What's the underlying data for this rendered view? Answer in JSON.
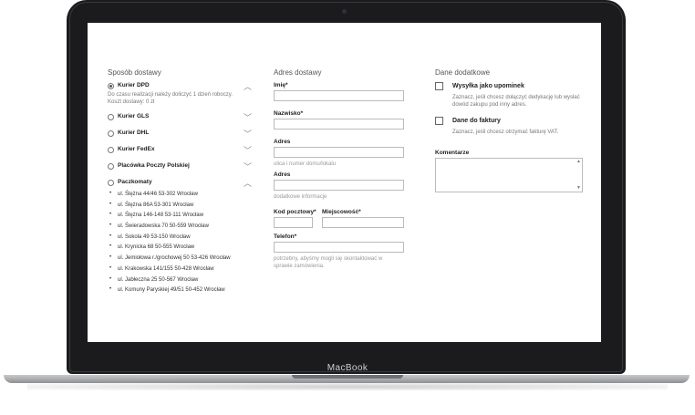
{
  "device": {
    "brand": "MacBook"
  },
  "delivery": {
    "title": "Sposób dostawy",
    "options": [
      {
        "label": "Kurier DPD",
        "selected": true,
        "expanded": true
      },
      {
        "label": "Kurier GLS",
        "selected": false,
        "expanded": false
      },
      {
        "label": "Kurier DHL",
        "selected": false,
        "expanded": false
      },
      {
        "label": "Kurier FedEx",
        "selected": false,
        "expanded": false
      },
      {
        "label": "Placówka Poczty Polskiej",
        "selected": false,
        "expanded": false
      },
      {
        "label": "Paczkomaty",
        "selected": false,
        "expanded": true
      }
    ],
    "dpd_note_1": "Do czasu realizacji należy doliczyć 1 dzień roboczy.",
    "dpd_note_2": "Koszt dostawy: 0 zł",
    "paczkomaty": [
      "ul. Ślężna 44/46 53-302 Wrocław",
      "ul. Ślężna 86A 53-301 Wrocław",
      "ul. Ślężna 146-148 53-111 Wrocław",
      "ul. Świeradowska 70 50-559 Wrocław",
      "ul. Sokola 49 53-150 Wrocław",
      "ul. Krynicka 68 50-555 Wrocław",
      "ul. Jemiołowa r./grochowej 50 53-426 Wrocław",
      "ul. Krakowska 141/155 50-428 Wrocław",
      "ul. Jabłeczna 25 50-567 Wrocław",
      "ul. Komuny Paryskiej 49/51 50-452 Wrocław"
    ]
  },
  "address": {
    "title": "Adres dostawy",
    "first_name_label": "Imię*",
    "last_name_label": "Nazwisko*",
    "address1_label": "Adres",
    "address1_hint": "ulica i numer domu/lokalu",
    "address2_label": "Adres",
    "address2_hint": "dodatkowe informacje",
    "postal_label": "Kod pocztowy*",
    "city_label": "Miejscowość*",
    "phone_label": "Telefon*",
    "phone_hint": "potrzebny, abyśmy mogli się skontaktować w sprawie zamówienia."
  },
  "extra": {
    "title": "Dane dodatkowe",
    "reminder_title": "Wysyłka jako upominek",
    "reminder_desc": "Zaznacz, jeśli chcesz dołączyć dedykację lub wysłać dowód zakupu pod inny adres.",
    "invoice_title": "Dane do faktury",
    "invoice_desc": "Zaznacz, jeśli chcesz otrzymać fakturę VAT.",
    "comment_label": "Komentarze"
  }
}
